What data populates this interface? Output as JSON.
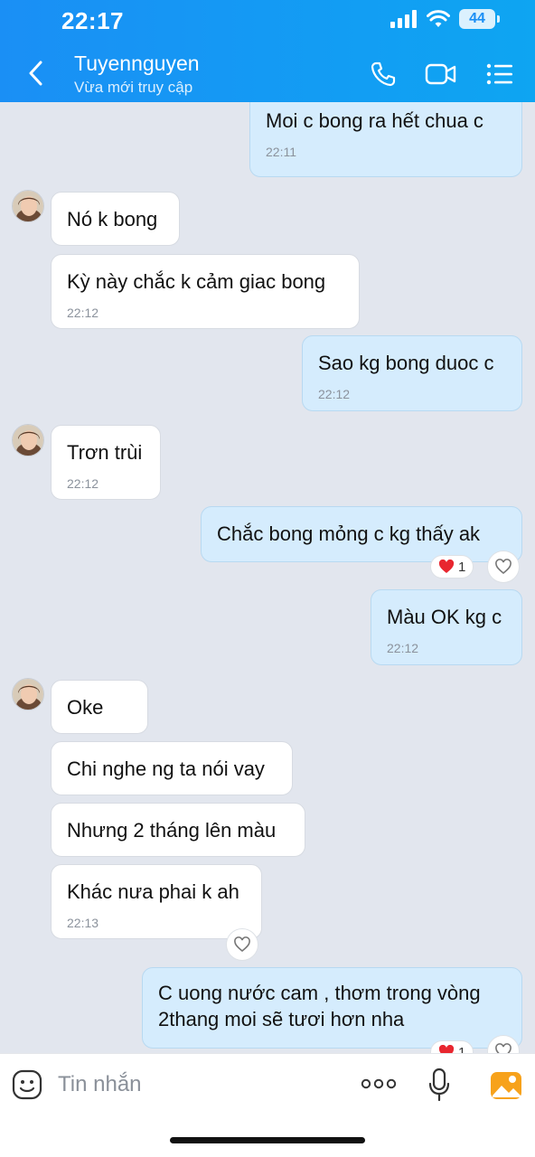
{
  "status_bar": {
    "time": "22:17",
    "battery": "44"
  },
  "header": {
    "contact_name": "Tuyennguyen",
    "contact_status": "Vừa mới truy cập",
    "icons": [
      "back-icon",
      "phone-icon",
      "video-call-icon",
      "menu-list-icon"
    ]
  },
  "messages": [
    {
      "dir": "out",
      "text": "Moi c bong ra hết chua c",
      "time": "22:11"
    },
    {
      "dir": "in",
      "text": "Nó k bong"
    },
    {
      "dir": "in",
      "text": "Kỳ này chắc k cảm giac bong",
      "time": "22:12"
    },
    {
      "dir": "out",
      "text": "Sao kg bong duoc c",
      "time": "22:12"
    },
    {
      "dir": "in",
      "text": "Trơn trùi",
      "time": "22:12"
    },
    {
      "dir": "out",
      "text": "Chắc bong mỏng c kg thấy ak",
      "reaction_count": "1"
    },
    {
      "dir": "out",
      "text": "Màu OK kg c",
      "time": "22:12"
    },
    {
      "dir": "in",
      "text": "Oke"
    },
    {
      "dir": "in",
      "text": "Chi nghe ng ta nói vay"
    },
    {
      "dir": "in",
      "text": "Nhưng 2 tháng lên màu"
    },
    {
      "dir": "in",
      "text": "Khác nưa phai k ah",
      "time": "22:13"
    },
    {
      "dir": "out",
      "line1": "C uong nước cam , thơm trong vòng",
      "line2": "2thang moi sẽ tươi hơn nha",
      "reaction_count": "1"
    }
  ],
  "input_bar": {
    "placeholder": "Tin nhắn",
    "icons": [
      "emoji-sticker-icon",
      "more-options-icon",
      "microphone-icon",
      "image-gallery-icon"
    ]
  },
  "colors": {
    "header": "#1a8ff5",
    "outgoing_bubble": "#d5ecfd",
    "incoming_bubble": "#ffffff",
    "background": "#e2e6ee"
  }
}
